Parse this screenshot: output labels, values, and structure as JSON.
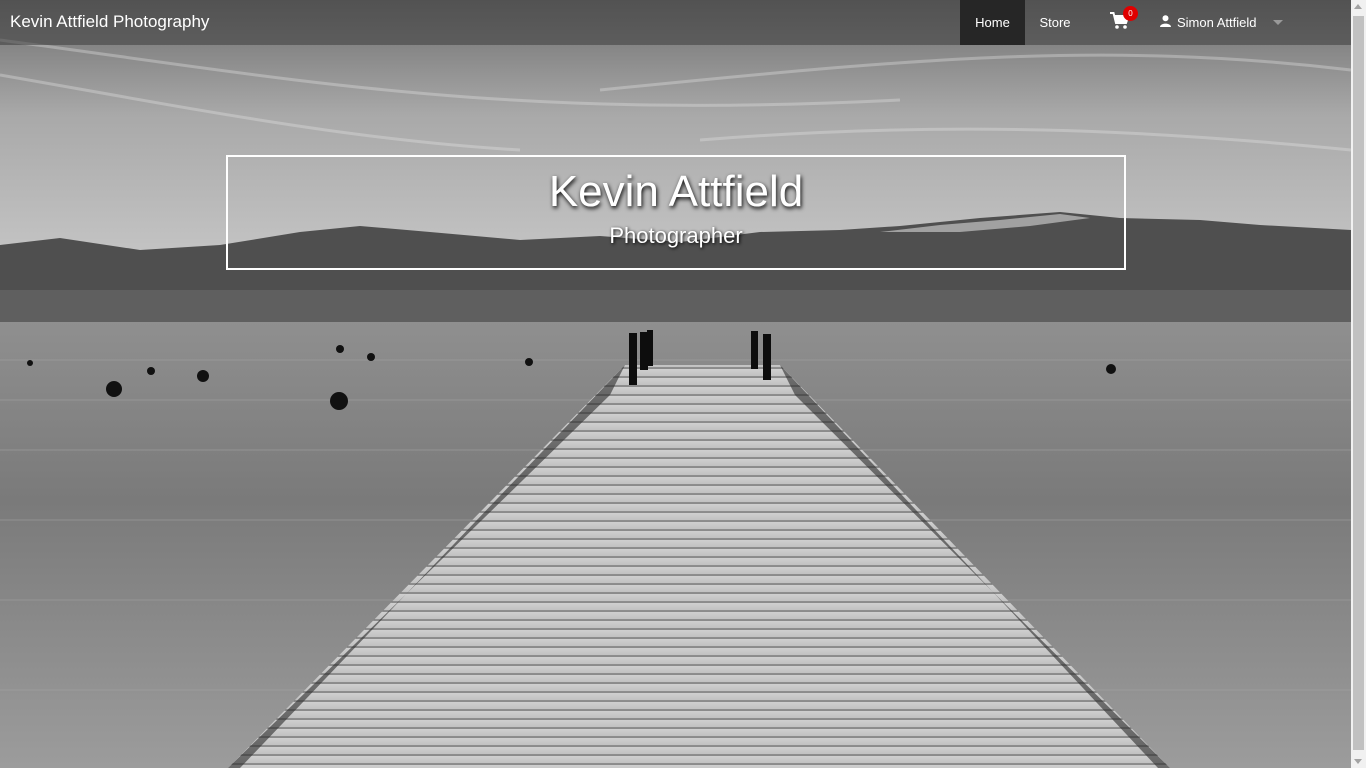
{
  "navbar": {
    "brand": "Kevin Attfield Photography",
    "items": [
      {
        "label": "Home",
        "active": true
      },
      {
        "label": "Store",
        "active": false
      }
    ],
    "cart": {
      "icon": "shopping-cart-icon",
      "count": "0",
      "badge_color": "#e00000"
    },
    "user": {
      "icon": "user-icon",
      "name": "Simon Attfield",
      "menu_icon": "caret-down-icon"
    }
  },
  "hero": {
    "title": "Kevin Attfield",
    "subtitle": "Photographer"
  },
  "background": {
    "description_icon": "lake-pier-photo",
    "tone": "grayscale"
  }
}
